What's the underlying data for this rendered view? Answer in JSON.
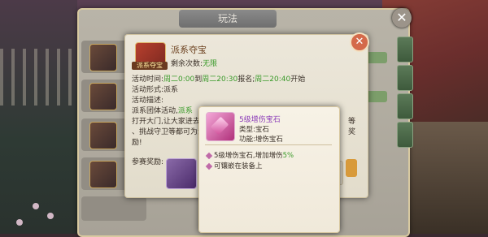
{
  "outer_panel": {
    "title": "玩法"
  },
  "activity": {
    "title": "派系夺宝",
    "icon_caption": "派系夺宝",
    "remaining_label": "剩余次数:",
    "remaining_value": "无限",
    "time_label": "活动时间:",
    "time_part1": "周二0:00",
    "time_mid1": "到",
    "time_part2": "周二20:30",
    "time_mid2": "报名;",
    "time_part3": "周二20:40",
    "time_end": "开始",
    "form_label": "活动形式:",
    "form_value": "派系",
    "desc_label": "活动描述:",
    "group_label": "派系团体活动,",
    "group_highlight": "派系",
    "desc_line1": "打开大门,让大家进去",
    "desc_line2": "、挑战守卫等都可为派",
    "desc_line3": "励!",
    "desc_right1": "等",
    "desc_right2": "奖",
    "reward_label": "参赛奖励:"
  },
  "tooltip": {
    "item_name": "5级增伤宝石",
    "type_label": "类型:",
    "type_value": "宝石",
    "func_label": "功能:",
    "func_value": "增伤宝石",
    "line1_prefix": "5级增伤宝石,增加增伤",
    "line1_value": "5%",
    "line2": "可镶嵌在装备上"
  },
  "colors": {
    "accent": "#3a9a2a",
    "item_name": "#8a3ab8",
    "close": "#d46a4a"
  }
}
